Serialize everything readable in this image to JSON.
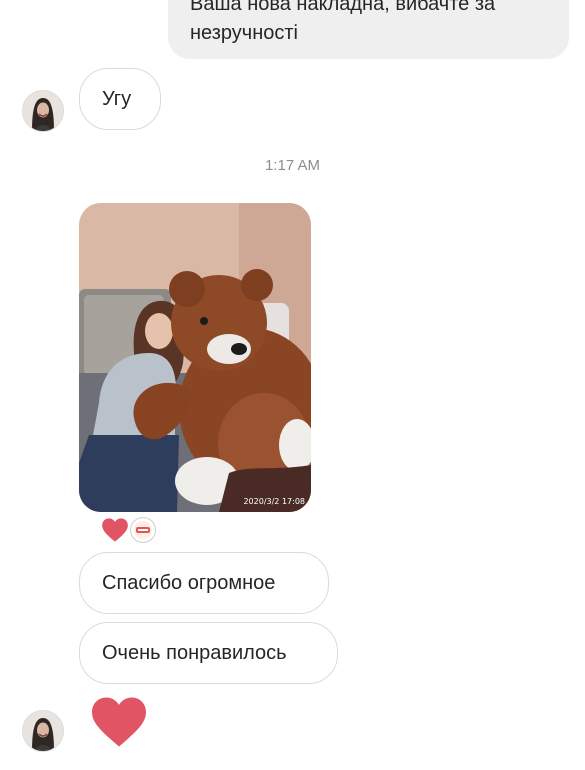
{
  "messages": {
    "outgoing_text": "Ваша нова накладна, вибачте за незручності",
    "incoming_short": "Угу",
    "timestamp": "1:17 AM",
    "photo_stamp": "2020/3/2  17:08",
    "reply_1": "Спасибо огромное",
    "reply_2": "Очень понравилось"
  },
  "colors": {
    "outgoing_bubble": "#efefef",
    "bubble_border": "#dbdbdb",
    "heart": "#e05463",
    "timestamp": "#8e8e8e"
  },
  "icons": {
    "reaction": "heart-icon",
    "sticker": "sticker-icon",
    "large_reaction": "heart-icon"
  }
}
